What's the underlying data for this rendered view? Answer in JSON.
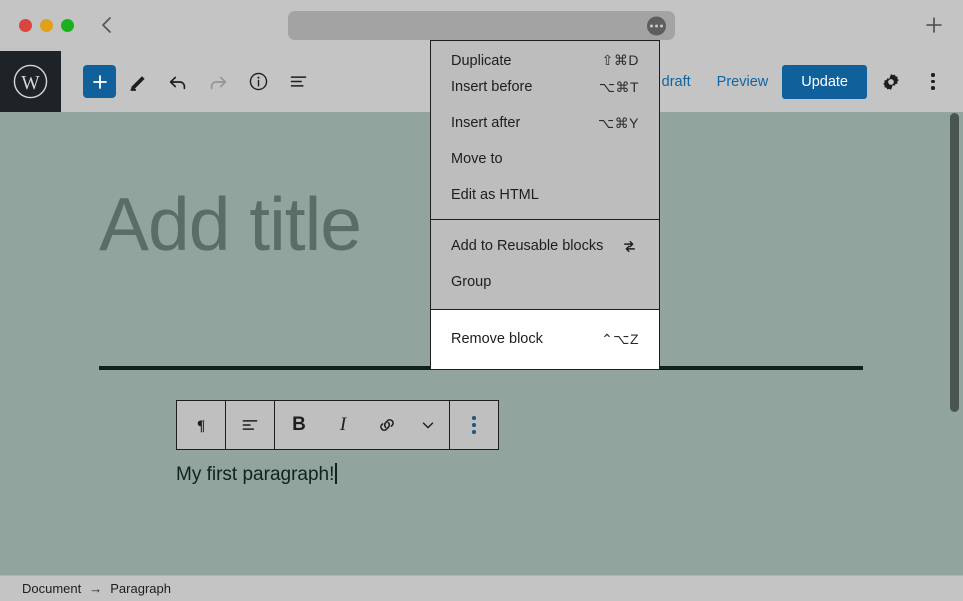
{
  "browser": {
    "traffic_lights": [
      "close",
      "minimize",
      "maximize"
    ],
    "back_icon": "chevron-left-icon",
    "url_value": "",
    "url_placeholder": "",
    "url_menu_icon": "ellipsis-icon",
    "new_tab_icon": "plus-icon"
  },
  "editor_header": {
    "logo_icon": "wordpress-logo-icon",
    "add_block_label": "+",
    "tools": [
      {
        "name": "add-block-button",
        "icon": "plus-icon",
        "label": "+"
      },
      {
        "name": "edit-tool-button",
        "icon": "pencil-icon",
        "label": ""
      },
      {
        "name": "undo-button",
        "icon": "undo-arrow-icon",
        "label": ""
      },
      {
        "name": "redo-button",
        "icon": "redo-arrow-icon",
        "label": ""
      },
      {
        "name": "details-button",
        "icon": "info-circle-icon",
        "label": ""
      },
      {
        "name": "list-view-button",
        "icon": "list-view-icon",
        "label": ""
      }
    ],
    "switch_to_draft_label": "Switch to draft",
    "preview_label": "Preview",
    "update_label": "Update",
    "settings_icon": "gear-icon",
    "more_options_icon": "kebab-menu-icon",
    "accent_color": "#10609b",
    "link_color": "#0d66a3"
  },
  "canvas": {
    "title_placeholder": "Add title",
    "paragraph_text": "My first paragraph!",
    "background_color": "#91a49d",
    "block_toolbar": {
      "items": [
        {
          "name": "block-type-paragraph-button",
          "icon": "paragraph-pilcrow-icon",
          "label": "¶"
        },
        {
          "name": "align-text-button",
          "icon": "align-left-icon",
          "label": ""
        },
        {
          "name": "bold-button",
          "icon": "bold-icon",
          "label": "B"
        },
        {
          "name": "italic-button",
          "icon": "italic-icon",
          "label": "I"
        },
        {
          "name": "link-button",
          "icon": "link-icon",
          "label": ""
        },
        {
          "name": "more-rich-text-button",
          "icon": "chevron-down-icon",
          "label": ""
        },
        {
          "name": "block-options-button",
          "icon": "kebab-menu-icon",
          "label": ""
        }
      ]
    }
  },
  "block_options_menu": {
    "sections": [
      {
        "items": [
          {
            "label": "Duplicate",
            "shortcut": "⇧⌘D",
            "icon": null,
            "clipped": true
          },
          {
            "label": "Insert before",
            "shortcut": "⌥⌘T",
            "icon": null,
            "clipped": false
          },
          {
            "label": "Insert after",
            "shortcut": "⌥⌘Y",
            "icon": null,
            "clipped": false
          },
          {
            "label": "Move to",
            "shortcut": "",
            "icon": null,
            "clipped": false
          },
          {
            "label": "Edit as HTML",
            "shortcut": "",
            "icon": null,
            "clipped": false
          }
        ]
      },
      {
        "items": [
          {
            "label": "Add to Reusable blocks",
            "shortcut": "",
            "icon": "reusable-block-icon",
            "clipped": false
          },
          {
            "label": "Group",
            "shortcut": "",
            "icon": null,
            "clipped": false
          }
        ]
      },
      {
        "highlighted": true,
        "items": [
          {
            "label": "Remove block",
            "shortcut": "⌃⌥Z",
            "icon": null,
            "clipped": false
          }
        ]
      }
    ]
  },
  "footer": {
    "breadcrumb": [
      "Document",
      "Paragraph"
    ],
    "separator": "→"
  },
  "scrollbar": {
    "name": "vertical-scrollbar",
    "thumb_color": "#4a5551"
  }
}
